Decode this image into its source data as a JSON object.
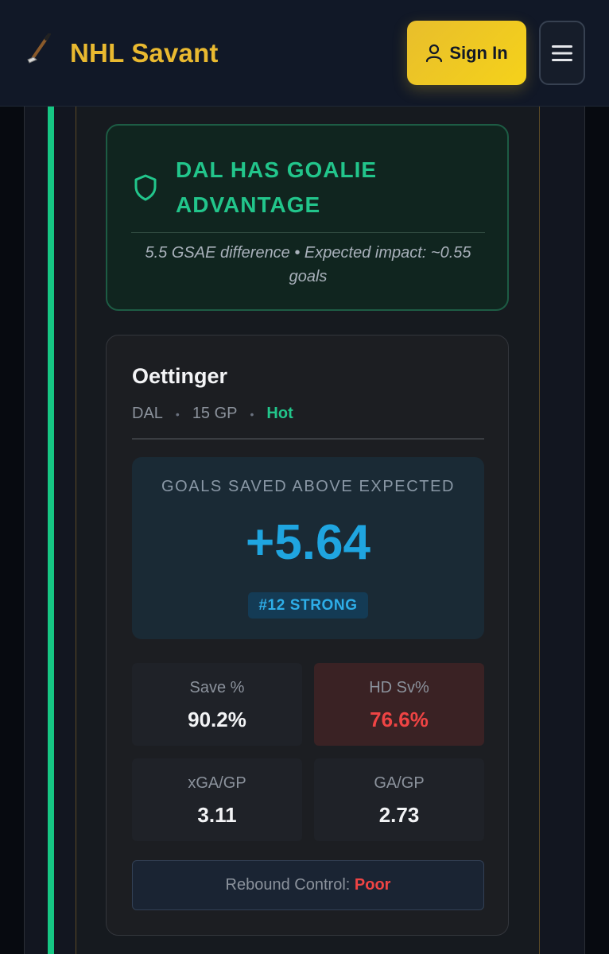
{
  "header": {
    "logo_icon": "hockey-stick-icon",
    "brand": "NHL Savant",
    "sign_in_label": "Sign In",
    "menu_icon": "hamburger-icon"
  },
  "advantage": {
    "icon": "shield-icon",
    "title": "DAL HAS GOALIE ADVANTAGE",
    "subtitle": "5.5 GSAE difference • Expected impact: ~0.55 goals"
  },
  "goalie": {
    "name": "Oettinger",
    "team": "DAL",
    "games": "15 GP",
    "form": "Hot",
    "gsax_label": "GOALS SAVED ABOVE EXPECTED",
    "gsax_value": "+5.64",
    "rank_badge": "#12 STRONG",
    "stats": [
      {
        "label": "Save %",
        "value": "90.2%"
      },
      {
        "label": "HD Sv%",
        "value": "76.6%"
      },
      {
        "label": "xGA/GP",
        "value": "3.11"
      },
      {
        "label": "GA/GP",
        "value": "2.73"
      }
    ],
    "rebound_label": "Rebound Control:",
    "rebound_value": "Poor"
  },
  "colors": {
    "brand": "#e9b930",
    "accent_green": "#22c58b",
    "accent_blue": "#1fa5e0",
    "negative_red": "#ef4444"
  }
}
